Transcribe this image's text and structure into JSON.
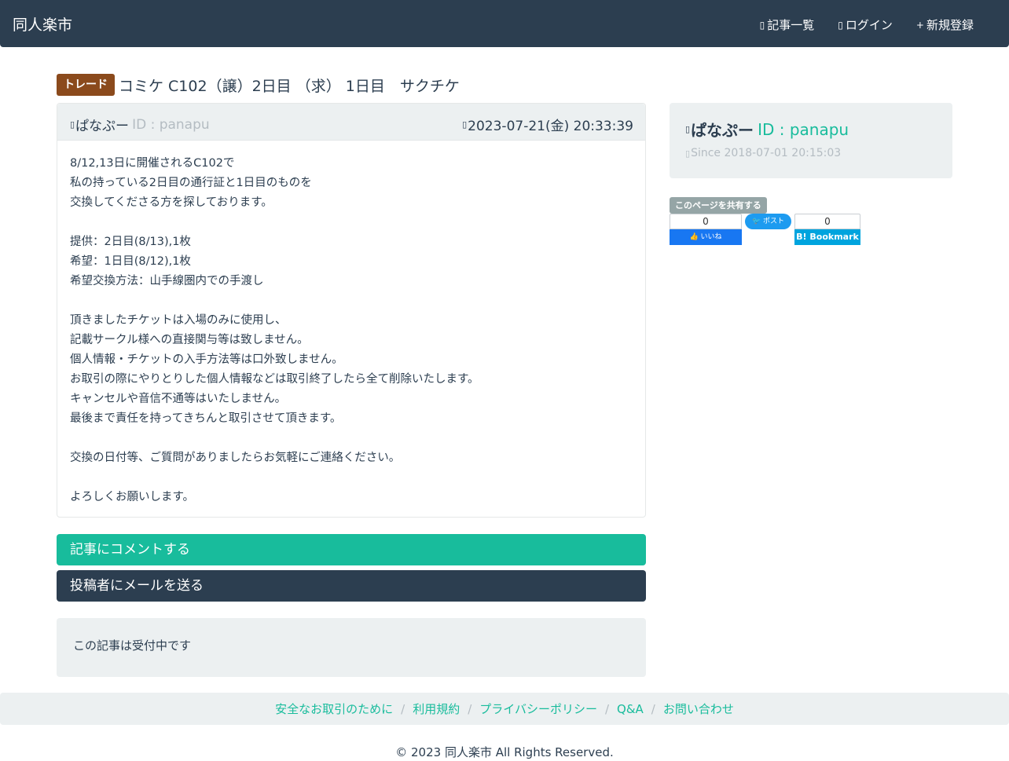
{
  "header": {
    "brand": "同人楽市",
    "links": [
      {
        "icon": "list-icon",
        "glyph": "▯",
        "label": "記事一覧"
      },
      {
        "icon": "login-icon",
        "glyph": "▯",
        "label": "ログイン"
      },
      {
        "icon": "plus-icon",
        "glyph": "+",
        "label": "新規登録"
      }
    ]
  },
  "post": {
    "badge": "トレード",
    "title": "コミケ C102（譲）2日目 （求） 1日目　サクチケ",
    "author_name": "ぱなぷー",
    "author_id": "ID : panapu",
    "date": "2023-07-21(金) 20:33:39",
    "user_icon_glyph": "▯",
    "clock_icon_glyph": "▯",
    "body_lines": [
      "8/12,13日に開催されるC102で",
      "私の持っている2日目の通行証と1日目のものを",
      "交換してくださる方を探しております。",
      "",
      "提供：2日目(8/13),1枚",
      "希望：1日目(8/12),1枚",
      "希望交換方法：山手線圏内での手渡し",
      "",
      "頂きましたチケットは入場のみに使用し、",
      "記載サークル様への直接関与等は致しません。",
      "個人情報・チケットの入手方法等は口外致しません。",
      "お取引の際にやりとりした個人情報などは取引終了したら全て削除いたします。",
      "キャンセルや音信不通等はいたしません。",
      "最後まで責任を持ってきちんと取引させて頂きます。",
      "",
      "交換の日付等、ご質問がありましたらお気軽にご連絡ください。",
      "",
      "よろしくお願いします。"
    ]
  },
  "actions": {
    "comment": "記事にコメントする",
    "mail": "投稿者にメールを送る"
  },
  "status": "この記事は受付中です",
  "profile": {
    "name": "ぱなぷー",
    "id": "ID : panapu",
    "since": "Since 2018-07-01 20:15:03",
    "user_icon_glyph": "▯",
    "clock_icon_glyph": "▯"
  },
  "share": {
    "label": "このページを共有する",
    "fb_count": "0",
    "fb_label": "👍 いいね",
    "tw_label": "🐦 ポスト",
    "hb_count": "0",
    "hb_label": "B! Bookmark"
  },
  "footer": {
    "links": [
      "安全なお取引のために",
      "利用規約",
      "プライバシーポリシー",
      "Q&A",
      "お問い合わせ"
    ],
    "separator": "/",
    "copyright": "© 2023 同人楽市 All Rights Reserved."
  },
  "colors": {
    "navbar": "#2c3e50",
    "accent": "#18bc9c",
    "badge": "#8b4a1c",
    "panel": "#ecf0f1"
  }
}
